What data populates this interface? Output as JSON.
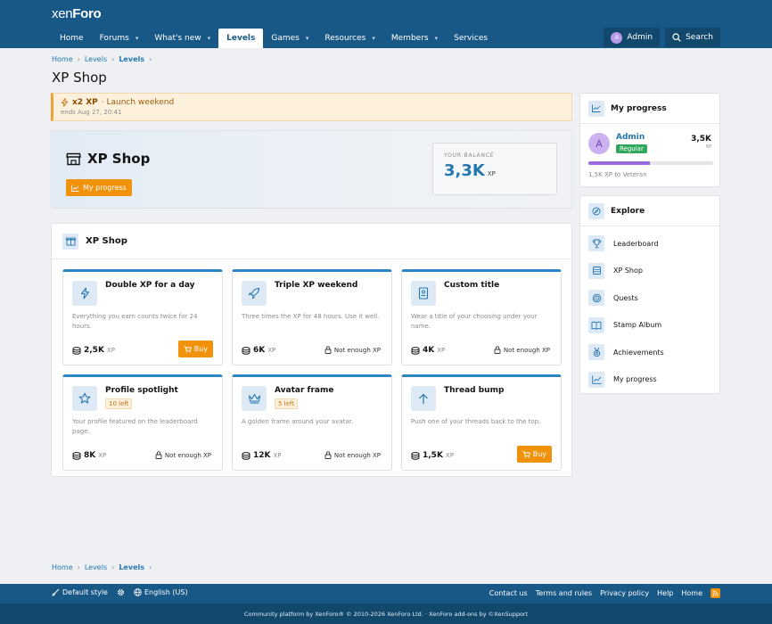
{
  "brand": {
    "logo_a": "xen",
    "logo_b": "Foro"
  },
  "nav": {
    "tabs": [
      {
        "label": "Home",
        "caret": false
      },
      {
        "label": "Forums",
        "caret": true
      },
      {
        "label": "What's new",
        "caret": true
      },
      {
        "label": "Levels",
        "caret": false,
        "active": true
      },
      {
        "label": "Games",
        "caret": true
      },
      {
        "label": "Resources",
        "caret": true
      },
      {
        "label": "Members",
        "caret": true
      },
      {
        "label": "Services",
        "caret": false
      }
    ],
    "user_label": "Admin",
    "user_initial": "A",
    "search_label": "Search"
  },
  "breadcrumb": {
    "items": [
      "Home",
      "Levels",
      "Levels"
    ]
  },
  "page": {
    "title": "XP Shop"
  },
  "notice": {
    "title": "x2 XP",
    "subtitle": "· Launch weekend",
    "ends": "ends Aug 27, 20:41"
  },
  "hero": {
    "title": "XP Shop",
    "progress_button": "My progress",
    "balance_label": "YOUR BALANCE",
    "balance_value": "3,3K",
    "balance_unit": "XP"
  },
  "shop": {
    "heading": "XP Shop",
    "items": [
      {
        "name": "Double XP for a day",
        "icon": "bolt-icon",
        "stock": "",
        "desc": "Everything you earn counts twice for 24 hours.",
        "price": "2,5K",
        "unit": "XP",
        "action": "Buy",
        "can_buy": true
      },
      {
        "name": "Triple XP weekend",
        "icon": "rocket-icon",
        "stock": "",
        "desc": "Three times the XP for 48 hours. Use it well.",
        "price": "6K",
        "unit": "XP",
        "action": "Not enough XP",
        "can_buy": false
      },
      {
        "name": "Custom title",
        "icon": "badge-icon",
        "stock": "",
        "desc": "Wear a title of your choosing under your name.",
        "price": "4K",
        "unit": "XP",
        "action": "Not enough XP",
        "can_buy": false
      },
      {
        "name": "Profile spotlight",
        "icon": "star-icon",
        "stock": "10 left",
        "desc": "Your profile featured on the leaderboard page.",
        "price": "8K",
        "unit": "XP",
        "action": "Not enough XP",
        "can_buy": false
      },
      {
        "name": "Avatar frame",
        "icon": "crown-icon",
        "stock": "5 left",
        "desc": "A golden frame around your avatar.",
        "price": "12K",
        "unit": "XP",
        "action": "Not enough XP",
        "can_buy": false
      },
      {
        "name": "Thread bump",
        "icon": "arrow-up-icon",
        "stock": "",
        "desc": "Push one of your threads back to the top.",
        "price": "1,5K",
        "unit": "XP",
        "action": "Buy",
        "can_buy": true
      }
    ]
  },
  "progress": {
    "heading": "My progress",
    "user": "Admin",
    "initial": "A",
    "role": "Regular",
    "xp": "3,5K",
    "xp_unit": "XP",
    "fill": 0.49,
    "to_next": "1,5K XP to Veteran"
  },
  "explore": {
    "heading": "Explore",
    "items": [
      {
        "label": "Leaderboard",
        "icon": "trophy-icon"
      },
      {
        "label": "XP Shop",
        "icon": "shop-icon"
      },
      {
        "label": "Quests",
        "icon": "target-icon"
      },
      {
        "label": "Stamp Album",
        "icon": "book-icon"
      },
      {
        "label": "Achievements",
        "icon": "medal-icon"
      },
      {
        "label": "My progress",
        "icon": "chart-icon"
      }
    ]
  },
  "footer": {
    "style": "Default style",
    "language": "English (US)",
    "links": [
      "Contact us",
      "Terms and rules",
      "Privacy policy",
      "Help",
      "Home"
    ],
    "copyright": "Community platform by XenForo® © 2010-2026 XenForo Ltd. · XenForo add-ons by ©XenSupport"
  },
  "colors": {
    "header": "#185886",
    "accent": "#2577b1",
    "buy": "#f0920c",
    "role": "#2fa85b",
    "progress": "#9a6ae0"
  }
}
